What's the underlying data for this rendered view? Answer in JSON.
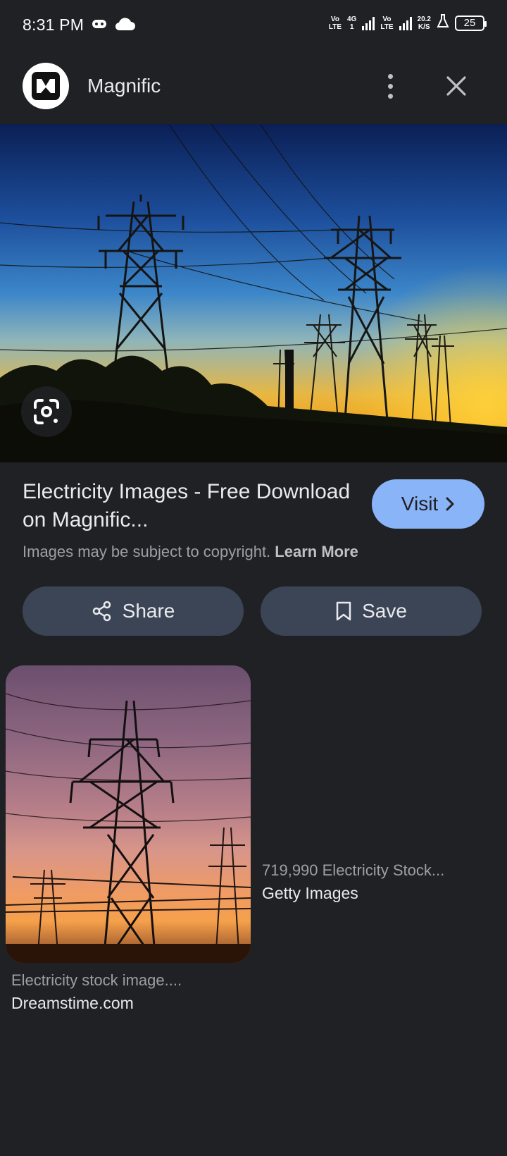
{
  "status_bar": {
    "time": "8:31 PM",
    "net1_top": "Vo",
    "net1_bottom": "LTE",
    "net2_top": "4G",
    "net2_bottom": "1",
    "net3_top": "Vo",
    "net3_bottom": "LTE",
    "speed_value": "20.2",
    "speed_unit": "K/S",
    "battery": "25",
    "icons": [
      "game-controller-icon",
      "cloud-icon",
      "signal-icon",
      "flask-icon",
      "battery-icon"
    ]
  },
  "header": {
    "site_name": "Magnific",
    "more_icon": "more-vert-icon",
    "close_icon": "close-icon"
  },
  "result": {
    "title": "Electricity Images - Free Download on Magnific...",
    "visit_label": "Visit",
    "copyright_text": "Images may be subject to copyright.",
    "learn_more": "Learn More",
    "share_label": "Share",
    "save_label": "Save"
  },
  "related": [
    {
      "title": "Electricity stock image....",
      "source": "Dreamstime.com"
    },
    {
      "title": "719,990 Electricity Stock...",
      "source": "Getty Images"
    }
  ],
  "colors": {
    "background": "#202124",
    "accent": "#8ab4f8",
    "button_bg": "#3c4556"
  }
}
